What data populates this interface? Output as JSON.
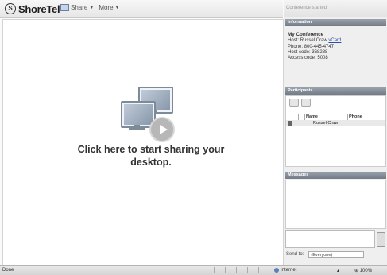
{
  "toolbar": {
    "brand": "ShoreTel",
    "share_label": "Share",
    "more_label": "More"
  },
  "main": {
    "share_prompt": "Click here to start sharing your desktop."
  },
  "panel": {
    "status_title": "Conference started",
    "info_header": "Information",
    "conf_name": "My Conference",
    "host_label": "Host:",
    "host_name": "Russel Craw",
    "vcard": "vCard",
    "phone_label": "Phone:",
    "phone": "800-445-4747",
    "host_code_label": "Host code:",
    "host_code": "368288",
    "access_code_label": "Access code:",
    "access_code": "5008",
    "participants_header": "Participants",
    "col_name": "Name",
    "col_phone": "Phone",
    "participants": [
      {
        "name": "Russel Craw"
      }
    ],
    "messages_header": "Messages",
    "send_to_label": "Send to:",
    "send_to_value": "(Everyone)"
  },
  "statusbar": {
    "left": "Done",
    "zone": "Internet",
    "zoom": "100%"
  }
}
